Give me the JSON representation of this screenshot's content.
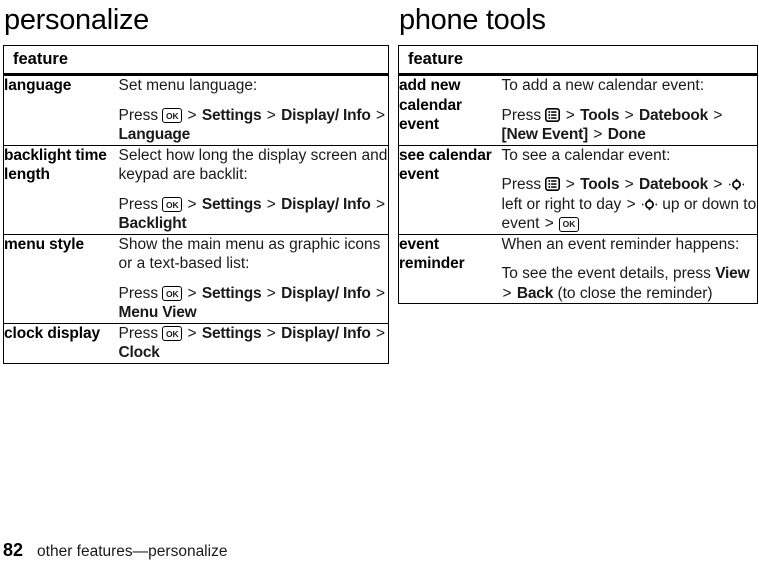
{
  "page": {
    "number": "82",
    "footer_text": "other features—personalize"
  },
  "icons": {
    "ok_key_label": "OK",
    "menu_key": "menu-key-icon",
    "nav_key": "navigation-key-icon"
  },
  "left_column": {
    "title": "personalize",
    "table": {
      "header": "feature",
      "rows": [
        {
          "feature": "language",
          "lines": [
            {
              "intro": "Set menu language:"
            },
            {
              "press": "Press",
              "key": "ok",
              "path": [
                "Settings",
                "Display/ Info",
                "Language"
              ]
            }
          ]
        },
        {
          "feature": "backlight time length",
          "lines": [
            {
              "intro": "Select how long the display screen and keypad are backlit:"
            },
            {
              "press": "Press",
              "key": "ok",
              "path": [
                "Settings",
                "Display/ Info",
                "Backlight"
              ]
            }
          ]
        },
        {
          "feature": "menu style",
          "lines": [
            {
              "intro": "Show the main menu as graphic icons or a text-based list:"
            },
            {
              "press": "Press",
              "key": "ok",
              "path": [
                "Settings",
                "Display/ Info",
                "Menu View"
              ]
            }
          ]
        },
        {
          "feature": "clock display",
          "lines": [
            {
              "press": "Press",
              "key": "ok",
              "path": [
                "Settings",
                "Display/ Info",
                "Clock"
              ]
            }
          ]
        }
      ]
    }
  },
  "right_column": {
    "title": "phone tools",
    "table": {
      "header": "feature",
      "rows": [
        {
          "feature": "add new calendar event",
          "intro": "To add a new calendar event:",
          "press": "Press",
          "key": "menu",
          "path": [
            "Tools",
            "Datebook",
            "[New Event]",
            "Done"
          ]
        },
        {
          "feature": "see calendar event",
          "intro": "To see a calendar event:",
          "press": "Press",
          "key": "menu",
          "path": [
            "Tools",
            "Datebook"
          ],
          "nav_text_1": "left or right to day",
          "nav_text_2": "up or down to event"
        },
        {
          "feature": "event reminder",
          "intro": "When an event reminder happens:",
          "detail_pre": "To see the event details, press",
          "detail_keys": [
            "View",
            "Back"
          ],
          "detail_post": "(to close the reminder)"
        }
      ]
    }
  }
}
